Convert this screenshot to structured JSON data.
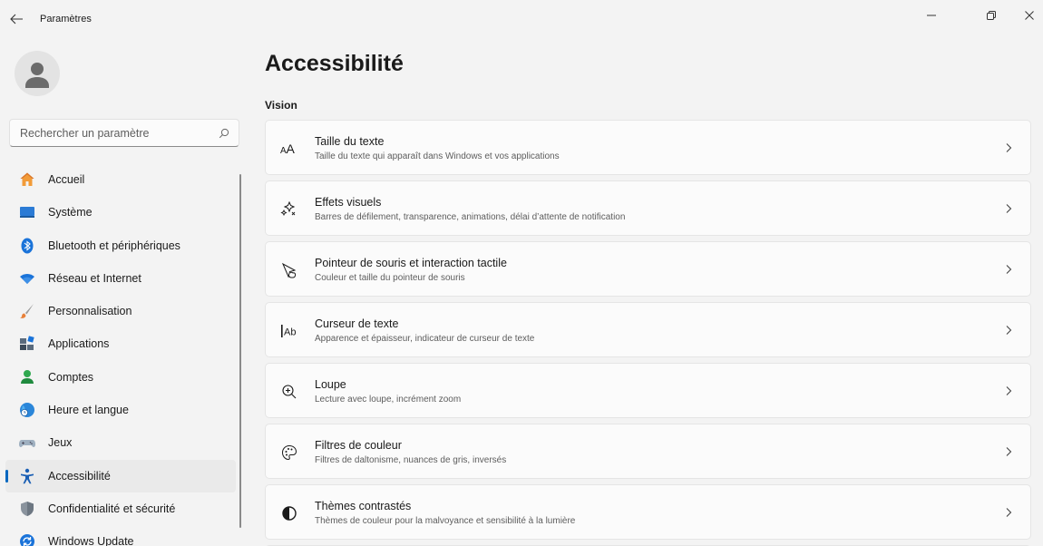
{
  "window": {
    "title": "Paramètres",
    "controls": [
      "minimize",
      "restore",
      "close"
    ]
  },
  "search": {
    "placeholder": "Rechercher un paramètre"
  },
  "sidebar": {
    "items": [
      {
        "label": "Accueil",
        "icon": "home-icon"
      },
      {
        "label": "Système",
        "icon": "system-icon"
      },
      {
        "label": "Bluetooth et périphériques",
        "icon": "bluetooth-icon"
      },
      {
        "label": "Réseau et Internet",
        "icon": "wifi-icon"
      },
      {
        "label": "Personnalisation",
        "icon": "brush-icon"
      },
      {
        "label": "Applications",
        "icon": "apps-icon"
      },
      {
        "label": "Comptes",
        "icon": "account-icon"
      },
      {
        "label": "Heure et langue",
        "icon": "globe-clock-icon"
      },
      {
        "label": "Jeux",
        "icon": "gamepad-icon"
      },
      {
        "label": "Accessibilité",
        "icon": "accessibility-icon",
        "active": true
      },
      {
        "label": "Confidentialité et sécurité",
        "icon": "shield-icon"
      },
      {
        "label": "Windows Update",
        "icon": "update-icon"
      }
    ]
  },
  "main": {
    "title": "Accessibilité",
    "section": "Vision",
    "cards": [
      {
        "title": "Taille du texte",
        "desc": "Taille du texte qui apparaît dans Windows et vos applications",
        "icon": "text-size-icon"
      },
      {
        "title": "Effets visuels",
        "desc": "Barres de défilement, transparence, animations, délai d’attente de notification",
        "icon": "sparkle-icon"
      },
      {
        "title": "Pointeur de souris et interaction tactile",
        "desc": "Couleur et taille du pointeur de souris",
        "icon": "pointer-touch-icon"
      },
      {
        "title": "Curseur de texte",
        "desc": "Apparence et épaisseur, indicateur de curseur de texte",
        "icon": "text-cursor-icon"
      },
      {
        "title": "Loupe",
        "desc": "Lecture avec loupe, incrément zoom",
        "icon": "magnifier-icon"
      },
      {
        "title": "Filtres de couleur",
        "desc": "Filtres de daltonisme, nuances de gris, inversés",
        "icon": "palette-icon"
      },
      {
        "title": "Thèmes contrastés",
        "desc": "Thèmes de couleur pour la malvoyance et sensibilité à la lumière",
        "icon": "contrast-icon"
      }
    ]
  },
  "colors": {
    "accent": "#0067c0",
    "background": "#f3f3f3",
    "card": "#fbfbfb"
  }
}
